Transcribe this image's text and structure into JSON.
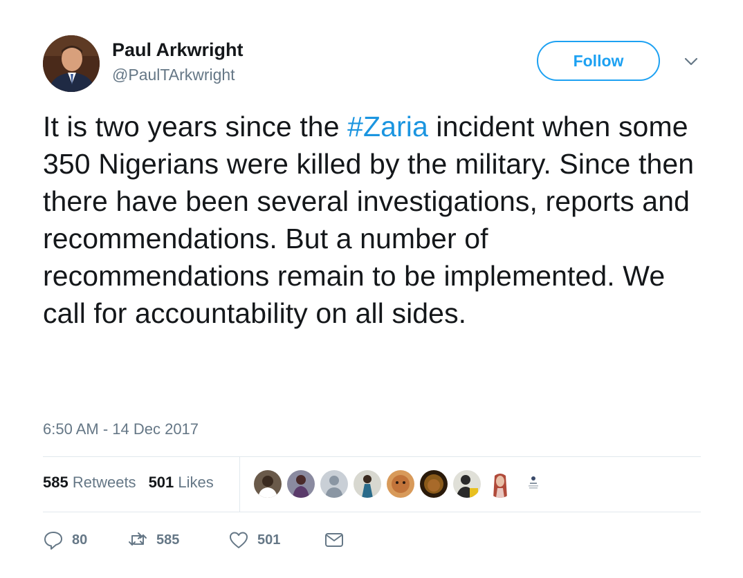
{
  "author": {
    "name": "Paul Arkwright",
    "handle": "@PaulTArkwright"
  },
  "follow_label": "Follow",
  "tweet": {
    "text_before": "It is two years since the ",
    "hashtag": "#Zaria",
    "text_after": " incident when some 350 Nigerians were killed by the military. Since then there have been several investigations, reports and recommendations. But a number of recommendations remain to be implemented. We call for accountability on all sides.",
    "timestamp": "6:50 AM - 14 Dec 2017"
  },
  "stats": {
    "retweets_count": "585",
    "retweets_label": "Retweets",
    "likes_count": "501",
    "likes_label": "Likes"
  },
  "likers": [
    {
      "color": "#3a2a1f"
    },
    {
      "color": "#5a3a6a"
    },
    {
      "color": "#c9cfd6"
    },
    {
      "color": "#2a6b8a"
    },
    {
      "color": "#c2743a"
    },
    {
      "color": "#8a5a1a"
    },
    {
      "color": "#2a2a2a"
    },
    {
      "color": "#e8c7c0"
    },
    {
      "color": "#ffffff"
    }
  ],
  "actions": {
    "reply_count": "80",
    "retweet_count": "585",
    "like_count": "501"
  },
  "colors": {
    "accent": "#1da1f2",
    "hashtag": "#1b95e0",
    "secondary_text": "#657786",
    "divider": "#e1e8ed"
  }
}
